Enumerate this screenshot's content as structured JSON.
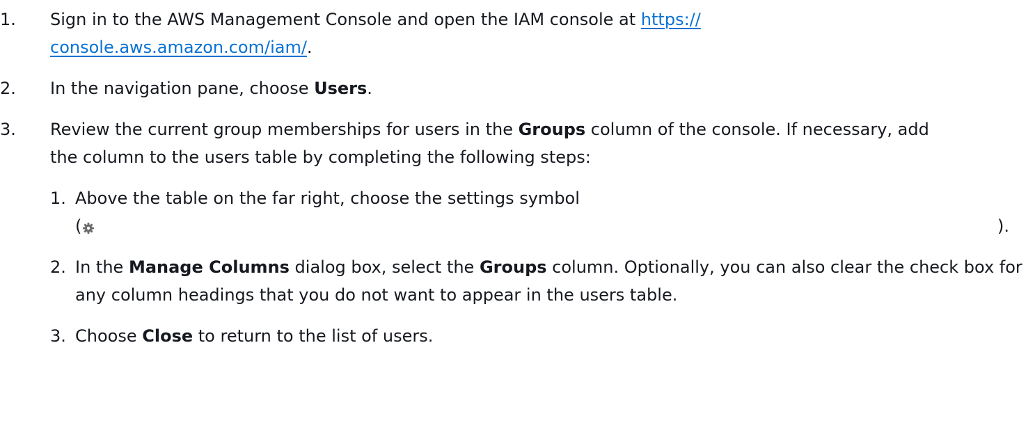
{
  "steps": [
    {
      "num": "1.",
      "text_before": "Sign in to the AWS Management Console and open the IAM console at ",
      "link_line1": "https://",
      "link_line2": "console.aws.amazon.com/iam/",
      "text_after": "."
    },
    {
      "num": "2.",
      "text_before": "In the navigation pane, choose ",
      "bold": "Users",
      "text_after": "."
    },
    {
      "num": "3.",
      "text_before": "Review the current group memberships for users in the ",
      "bold": "Groups",
      "text_after": " column of the console. If necessary, add the column to the users table by completing the following steps:",
      "substeps": [
        {
          "num": "1.",
          "text": "Above the table on the far right, choose the settings symbol",
          "paren_open": "(",
          "paren_close": ")."
        },
        {
          "num": "2.",
          "text_before": "In the ",
          "bold1": "Manage Columns",
          "text_middle": " dialog box, select the ",
          "bold2": "Groups",
          "text_after": " column. Optionally, you can also clear the check box for any column headings that you do not want to appear in the users table."
        },
        {
          "num": "3.",
          "text_before": "Choose ",
          "bold": "Close",
          "text_after": " to return to the list of users."
        }
      ]
    }
  ],
  "icons": {
    "settings": "gear-icon"
  },
  "colors": {
    "link": "#0972d3",
    "text": "#16191f"
  }
}
